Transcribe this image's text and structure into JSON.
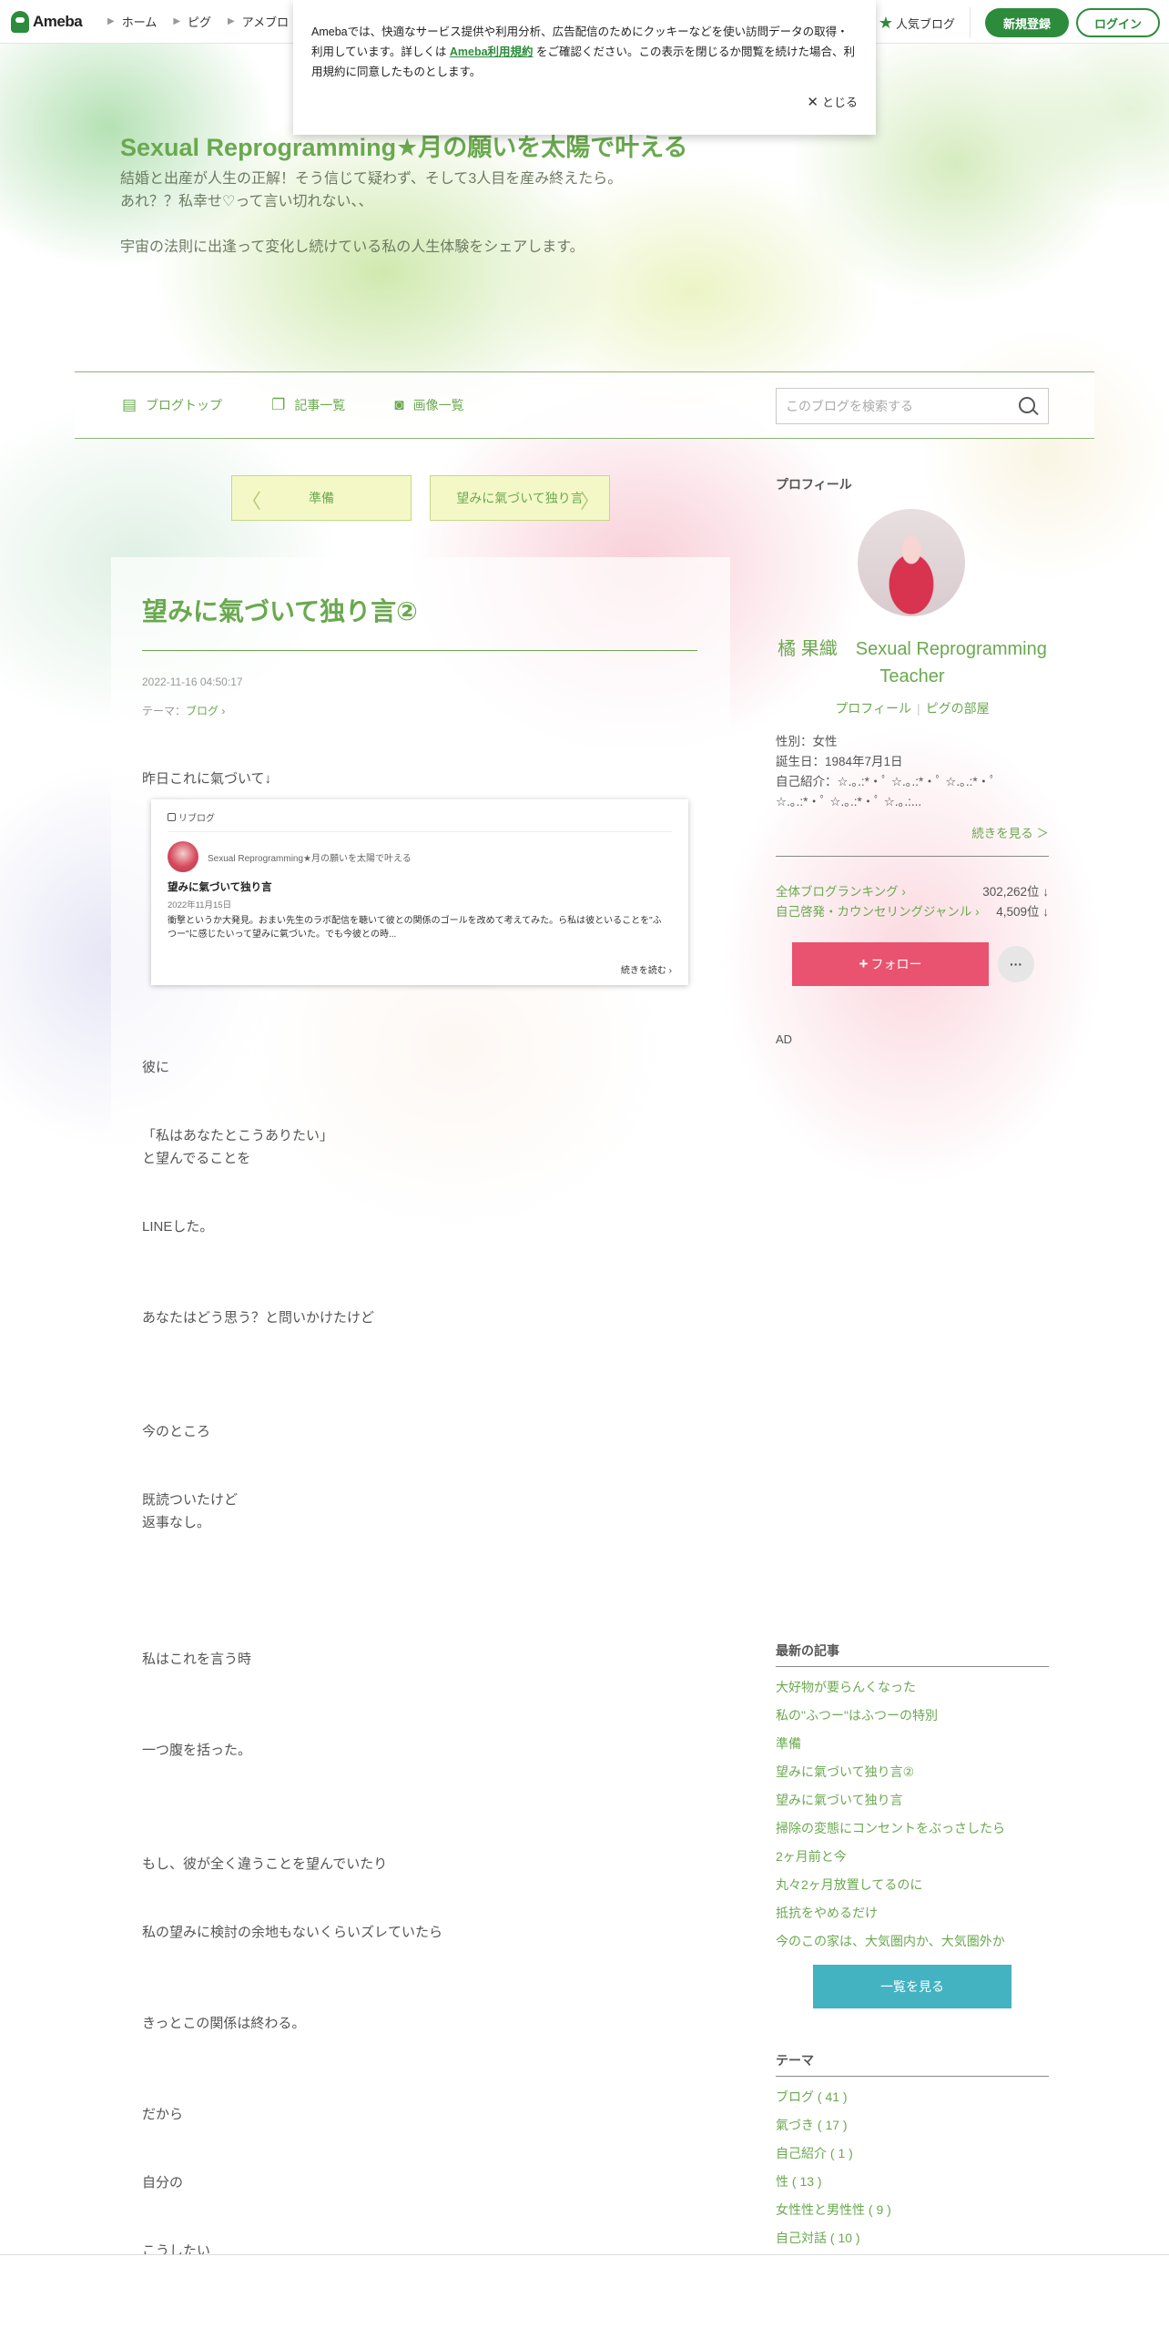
{
  "global_header": {
    "logo": "Ameba",
    "nav": [
      "ホーム",
      "ピグ",
      "アメブロ"
    ],
    "popular_blog": "人気ブログ",
    "register": "新規登録",
    "login": "ログイン"
  },
  "cookie": {
    "text_before": "Amebaでは、快適なサービス提供や利用分析、広告配信のためにクッキーなどを使い訪問データの取得・利用しています。詳しくは ",
    "link": "Ameba利用規約",
    "text_after": " をご確認ください。この表示を閉じるか閲覧を続けた場合、利用規約に同意したものとします。",
    "close": "とじる"
  },
  "blog": {
    "title": "Sexual Reprogramming★月の願いを太陽で叶える",
    "description": "結婚と出産が人生の正解！そう信じて疑わず、そして3人目を産み終えたら。\nあれ？？私幸せ♡って言い切れない、、\n\n宇宙の法則に出逢って変化し続けている私の人生体験をシェアします。"
  },
  "blog_menu": {
    "top": "ブログトップ",
    "entries": "記事一覧",
    "images": "画像一覧",
    "search_placeholder": "このブログを検索する"
  },
  "pager": {
    "prev": "準備",
    "next": "望みに氣づいて独り言"
  },
  "article": {
    "title": "望みに氣づいて独り言②",
    "date": "2022-11-16 04:50:17",
    "theme_label": "テーマ：",
    "theme": "ブログ",
    "paragraphs": [
      "昨日これに氣づいて↓",
      "彼に",
      "「私はあなたとこうありたい」\nと望んでることを",
      "LINEした。",
      "あなたはどう思う？と問いかけたけど",
      "今のところ",
      "既読ついたけど\n返事なし。",
      "私はこれを言う時",
      "一つ腹を括った。",
      "もし、彼が全く違うことを望んでいたり",
      "私の望みに検討の余地もないくらいズレていたら",
      "きっとこの関係は終わる。",
      "だから",
      "自分の",
      "こうしたい"
    ],
    "reblog": {
      "label": "リブログ",
      "blog_name": "Sexual Reprogramming★月の願いを太陽で叶える",
      "title": "望みに氣づいて独り言",
      "date": "2022年11月15日",
      "excerpt": "衝撃というか大発見。おまい先生のラボ配信を聴いて彼との関係のゴールを改めて考えてみた。ら私は彼といることを\"ふつー\"に感じたいって望みに氣づいた。でも今彼との時...",
      "more": "続きを読む"
    }
  },
  "profile": {
    "heading": "プロフィール",
    "name": "橘 果織　Sexual Reprogramming Teacher",
    "link_profile": "プロフィール",
    "link_room": "ピグの部屋",
    "info": "性別：女性\n誕生日：1984年7月1日\n自己紹介：☆.｡.:*・ﾟ ☆.｡.:*・ﾟ ☆.｡.:*・ﾟ\n☆.｡.:*・ﾟ ☆.｡.:*・ﾟ ☆.｡.:...",
    "more": "続きを見る ＞",
    "rank_all_label": "全体ブログランキング",
    "rank_all_value": "302,262位 ↓",
    "rank_genre_label": "自己啓発・カウンセリングジャンル",
    "rank_genre_value": "4,509位 ↓",
    "follow": "フォロー",
    "more_button": "···",
    "ad": "AD"
  },
  "recent": {
    "heading": "最新の記事",
    "items": [
      "大好物が要らんくなった",
      "私の\"ふつー\"はふつーの特別",
      "準備",
      "望みに氣づいて独り言②",
      "望みに氣づいて独り言",
      "掃除の変態にコンセントをぶっさしたら",
      "2ヶ月前と今",
      "丸々2ヶ月放置してるのに",
      "抵抗をやめるだけ",
      "今のこの家は、大気圏内か、大気圏外か"
    ],
    "view_all": "一覧を見る"
  },
  "themes": {
    "heading": "テーマ",
    "items": [
      "ブログ ( 41 )",
      "氣づき ( 17 )",
      "自己紹介 ( 1 )",
      "性 ( 13 )",
      "女性性と男性性 ( 9 )",
      "自己対話 ( 10 )"
    ]
  }
}
